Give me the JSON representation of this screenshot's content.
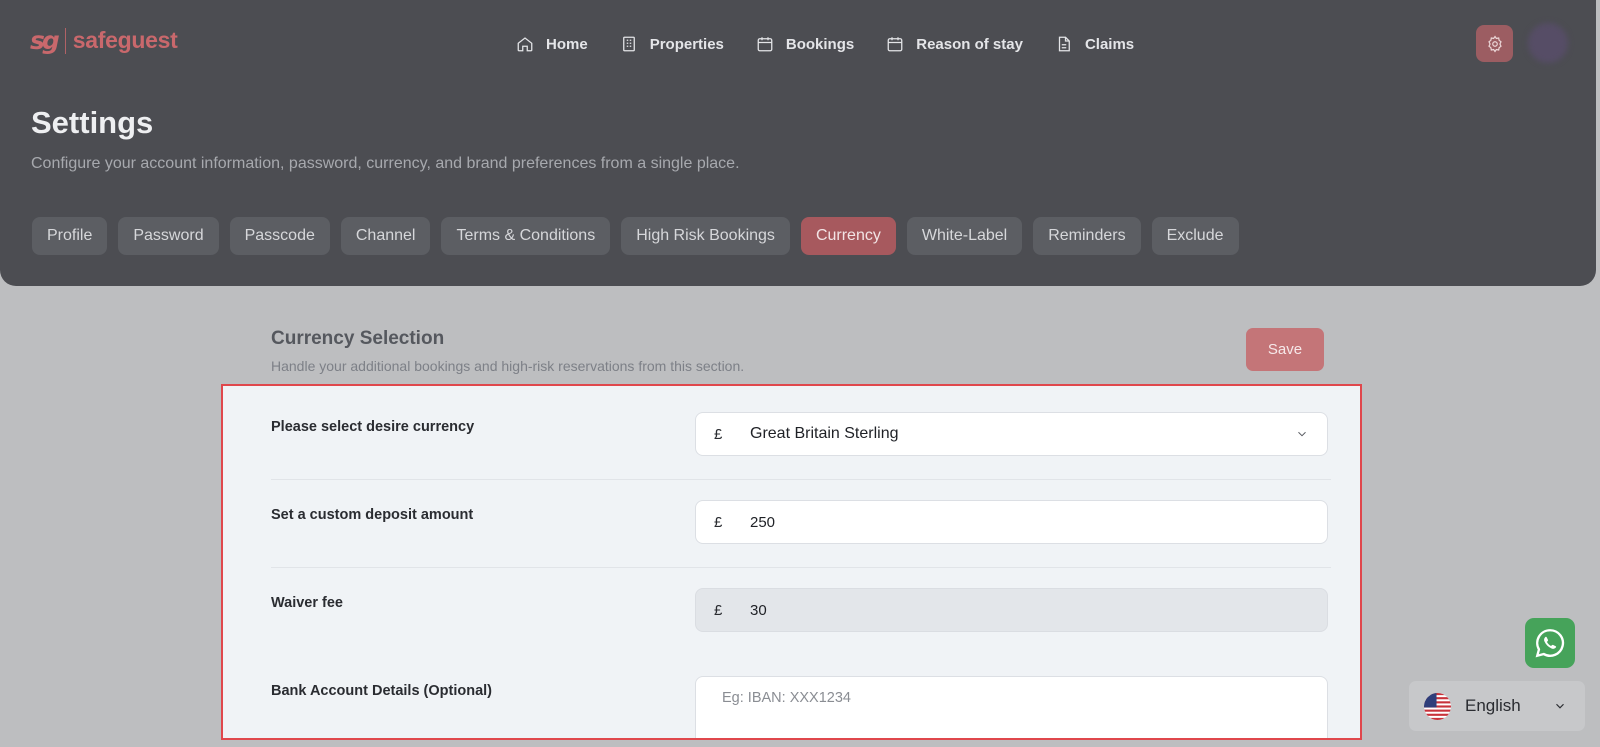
{
  "app": {
    "logo_mark": "sg",
    "logo_text": "safeguest",
    "brand_color": "#c9686c",
    "accent_active_tab": "#a7595e"
  },
  "nav": {
    "items": [
      {
        "label": "Home",
        "icon": "home-icon"
      },
      {
        "label": "Properties",
        "icon": "building-icon"
      },
      {
        "label": "Bookings",
        "icon": "calendar-icon"
      },
      {
        "label": "Reason of stay",
        "icon": "calendar-icon"
      },
      {
        "label": "Claims",
        "icon": "document-icon"
      }
    ],
    "settings_icon": "gear-icon"
  },
  "page": {
    "title": "Settings",
    "subtitle": "Configure your account information, password, currency, and brand preferences from a single place."
  },
  "tabs": [
    {
      "label": "Profile",
      "active": false
    },
    {
      "label": "Password",
      "active": false
    },
    {
      "label": "Passcode",
      "active": false
    },
    {
      "label": "Channel",
      "active": false
    },
    {
      "label": "Terms & Conditions",
      "active": false
    },
    {
      "label": "High Risk Bookings",
      "active": false
    },
    {
      "label": "Currency",
      "active": true
    },
    {
      "label": "White-Label",
      "active": false
    },
    {
      "label": "Reminders",
      "active": false
    },
    {
      "label": "Exclude",
      "active": false
    }
  ],
  "section": {
    "title": "Currency Selection",
    "subtitle": "Handle your additional bookings and high-risk reservations from this section.",
    "save_label": "Save"
  },
  "form": {
    "currency": {
      "label": "Please select desire currency",
      "symbol": "£",
      "value": "Great Britain Sterling"
    },
    "deposit": {
      "label": "Set a custom deposit amount",
      "symbol": "£",
      "value": "250"
    },
    "waiver": {
      "label": "Waiver fee",
      "symbol": "£",
      "value": "30"
    },
    "bank": {
      "label": "Bank Account Details (Optional)",
      "placeholder": "Eg: IBAN: XXX1234"
    }
  },
  "widgets": {
    "whatsapp_icon": "whatsapp-icon",
    "language": "English",
    "flag_icon": "us-flag-icon"
  }
}
